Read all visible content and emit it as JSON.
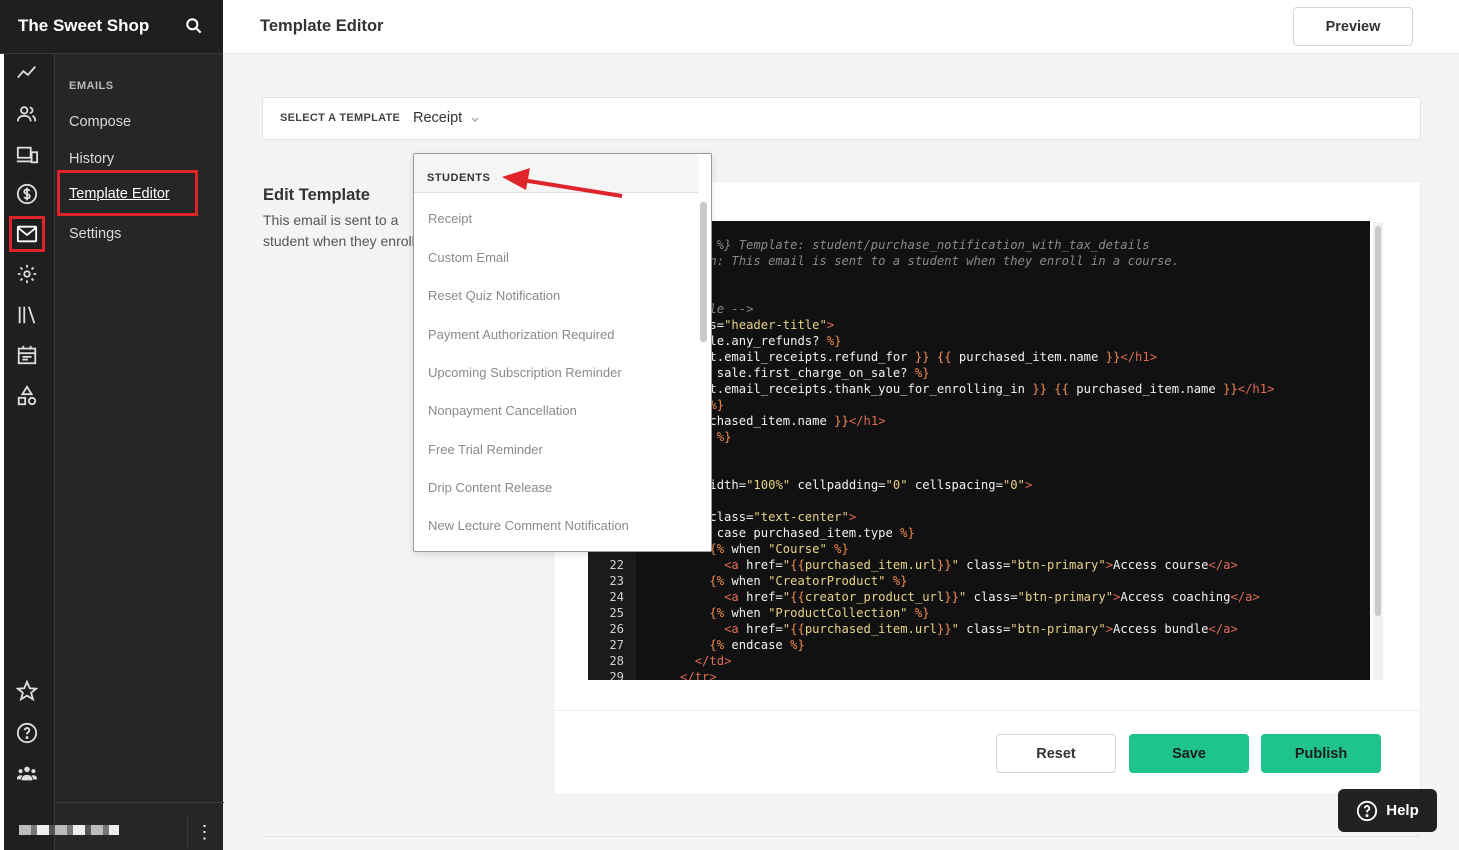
{
  "app": {
    "brand": "The Sweet Shop",
    "page_title": "Template Editor",
    "preview_label": "Preview"
  },
  "rail": {
    "icons": [
      "analytics-icon",
      "users-icon",
      "devices-icon",
      "dollar-icon",
      "mail-icon",
      "gear-icon",
      "library-icon",
      "calendar-icon",
      "shapes-icon",
      "star-icon",
      "question-icon",
      "community-icon"
    ],
    "active": "mail-icon"
  },
  "sidebar": {
    "section": "EMAILS",
    "items": [
      {
        "label": "Compose"
      },
      {
        "label": "History"
      },
      {
        "label": "Template Editor"
      },
      {
        "label": "Settings"
      }
    ],
    "active_item": "Template Editor"
  },
  "template_select": {
    "label": "SELECT A TEMPLATE",
    "value": "Receipt"
  },
  "edit": {
    "title": "Edit Template",
    "description": "This email is sent to a student when they enroll and pay for a course."
  },
  "dropdown": {
    "group": "STUDENTS",
    "options": [
      "Receipt",
      "Custom Email",
      "Reset Quiz Notification",
      "Payment Authorization Required",
      "Upcoming Subscription Reminder",
      "Nonpayment Cancellation",
      "Free Trial Reminder",
      "Drip Content Release",
      "New Lecture Comment Notification"
    ]
  },
  "code": {
    "lines": [
      {
        "n": "",
        "text": "{% comment %} Template: student/purchase_notification_with_tax_details"
      },
      {
        "n": "",
        "text": "Description: This email is sent to a student when they enroll in a course."
      },
      {
        "n": "",
        "text": ""
      },
      {
        "n": "",
        "text": ""
      },
      {
        "n": "",
        "text": "<!-- Title -->"
      },
      {
        "n": "",
        "text": "<h1 class=\"header-title\">"
      },
      {
        "n": "",
        "text": "{% if sale.any_refunds? %}"
      },
      {
        "n": "",
        "text": "{{ text.email_receipts.refund_for }} {{ purchased_item.name }}</h1>"
      },
      {
        "n": "",
        "text": "{% elsif sale.first_charge_on_sale? %}"
      },
      {
        "n": "",
        "text": "{{ text.email_receipts.thank_you_for_enrolling_in }} {{ purchased_item.name }}</h1>"
      },
      {
        "n": "",
        "text": "{% else %}"
      },
      {
        "n": "",
        "text": "{{ purchased_item.name }}</h1>"
      },
      {
        "n": "",
        "text": "{% endif %}"
      },
      {
        "n": "",
        "text": ""
      },
      {
        "n": "",
        "text": ""
      },
      {
        "n": "",
        "text": "<table width=\"100%\" cellpadding=\"0\" cellspacing=\"0\">"
      },
      {
        "n": "",
        "text": "<tr>"
      },
      {
        "n": "",
        "text": "<td class=\"text-center\">"
      },
      {
        "n": "",
        "text": "{% case purchased_item.type %}"
      },
      {
        "n": "",
        "text": "{% when \"Course\" %}"
      },
      {
        "n": "22",
        "text": "<a href=\"{{purchased_item.url}}\" class=\"btn-primary\">Access course</a>"
      },
      {
        "n": "23",
        "text": "{% when \"CreatorProduct\" %}"
      },
      {
        "n": "24",
        "text": "<a href=\"{{creator_product_url}}\" class=\"btn-primary\">Access coaching</a>"
      },
      {
        "n": "25",
        "text": "{% when \"ProductCollection\" %}"
      },
      {
        "n": "26",
        "text": "<a href=\"{{purchased_item.url}}\" class=\"btn-primary\">Access bundle</a>"
      },
      {
        "n": "27",
        "text": "{% endcase %}"
      },
      {
        "n": "28",
        "text": "</td>"
      },
      {
        "n": "29",
        "text": "</tr>"
      }
    ]
  },
  "actions": {
    "reset": "Reset",
    "save": "Save",
    "publish": "Publish"
  },
  "help_label": "Help",
  "colors": {
    "accent": "#1fc48a",
    "highlight": "#e0242b",
    "sidebar_bg": "#262626"
  }
}
